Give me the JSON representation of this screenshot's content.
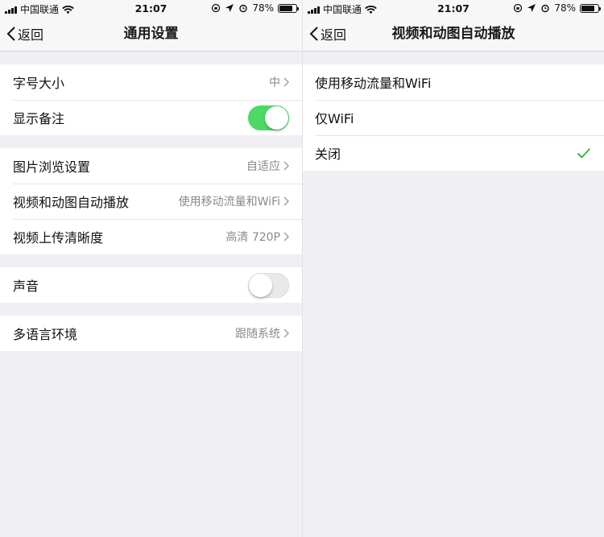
{
  "left": {
    "status": {
      "carrier": "中国联通",
      "time": "21:07",
      "battery": "78%"
    },
    "nav": {
      "back_label": "返回",
      "title": "通用设置"
    },
    "groups": {
      "g1": [
        {
          "label": "字号大小",
          "value": "中"
        },
        {
          "label": "显示备注",
          "toggle": "on"
        }
      ],
      "g2": [
        {
          "label": "图片浏览设置",
          "value": "自适应"
        },
        {
          "label": "视频和动图自动播放",
          "value": "使用移动流量和WiFi"
        },
        {
          "label": "视频上传清晰度",
          "value": "高清 720P"
        }
      ],
      "g3": [
        {
          "label": "声音",
          "toggle": "off"
        }
      ],
      "g4": [
        {
          "label": "多语言环境",
          "value": "跟随系统"
        }
      ]
    }
  },
  "right": {
    "status": {
      "carrier": "中国联通",
      "time": "21:07",
      "battery": "78%"
    },
    "nav": {
      "back_label": "返回",
      "title": "视频和动图自动播放"
    },
    "options": [
      {
        "label": "使用移动流量和WiFi",
        "selected": false
      },
      {
        "label": "仅WiFi",
        "selected": false
      },
      {
        "label": "关闭",
        "selected": true
      }
    ]
  },
  "colors": {
    "accent_green": "#4cd964",
    "check_green": "#1aad19",
    "background": "#efeff4"
  },
  "battery_level": 0.78
}
